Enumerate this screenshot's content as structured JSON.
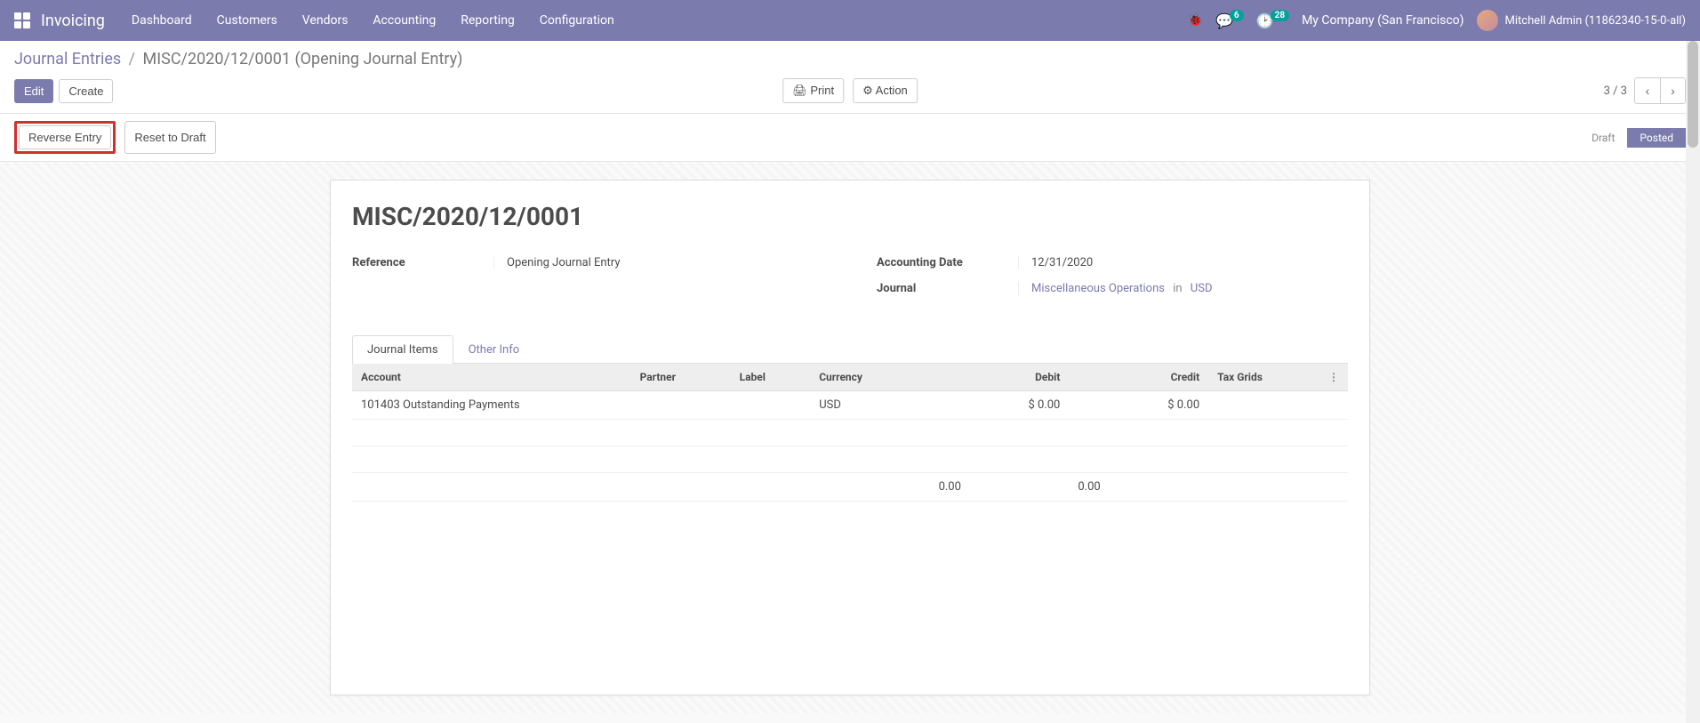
{
  "nav": {
    "app_title": "Invoicing",
    "menu": [
      "Dashboard",
      "Customers",
      "Vendors",
      "Accounting",
      "Reporting",
      "Configuration"
    ],
    "messages_badge": "6",
    "activities_badge": "28",
    "company": "My Company (San Francisco)",
    "user": "Mitchell Admin (11862340-15-0-all)"
  },
  "breadcrumb": {
    "root": "Journal Entries",
    "current": "MISC/2020/12/0001 (Opening Journal Entry)"
  },
  "toolbar": {
    "edit": "Edit",
    "create": "Create",
    "print": "Print",
    "action": "Action",
    "pager": "3 / 3"
  },
  "statusbar": {
    "reverse": "Reverse Entry",
    "reset": "Reset to Draft",
    "draft": "Draft",
    "posted": "Posted"
  },
  "record": {
    "title": "MISC/2020/12/0001",
    "reference_label": "Reference",
    "reference_value": "Opening Journal Entry",
    "date_label": "Accounting Date",
    "date_value": "12/31/2020",
    "journal_label": "Journal",
    "journal_link": "Miscellaneous Operations",
    "journal_in": "in",
    "currency_link": "USD"
  },
  "tabs": {
    "journal_items": "Journal Items",
    "other_info": "Other Info"
  },
  "table": {
    "headers": {
      "account": "Account",
      "partner": "Partner",
      "label": "Label",
      "currency": "Currency",
      "debit": "Debit",
      "credit": "Credit",
      "tax_grids": "Tax Grids"
    },
    "row": {
      "account": "101403 Outstanding Payments",
      "partner": "",
      "label": "",
      "currency": "USD",
      "debit": "$ 0.00",
      "credit": "$ 0.00",
      "tax_grids": ""
    },
    "totals": {
      "debit": "0.00",
      "credit": "0.00"
    }
  }
}
